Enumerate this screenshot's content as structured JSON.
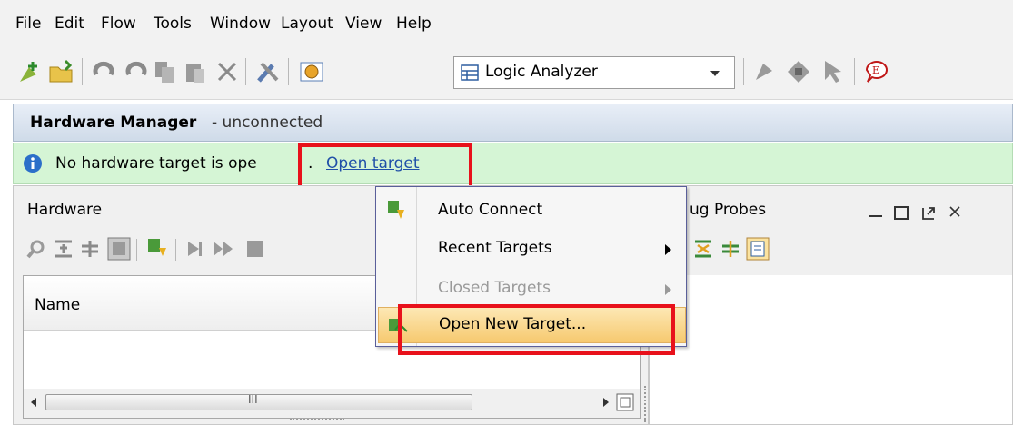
{
  "menu": [
    "File",
    "Edit",
    "Flow",
    "Tools",
    "Window",
    "Layout",
    "View",
    "Help"
  ],
  "toolbar": {
    "layout_value": "Logic Analyzer"
  },
  "hw_manager": {
    "title": "Hardware Manager",
    "status": "- unconnected"
  },
  "info": {
    "message": "No hardware target is ope",
    "suffix": ".",
    "link": "Open target"
  },
  "hardware_panel": {
    "title": "Hardware",
    "column_name": "Name",
    "scroll_label": "III"
  },
  "debug_panel": {
    "title": "ug Probes"
  },
  "context_menu": {
    "items": [
      {
        "label": "Auto Connect",
        "enabled": true
      },
      {
        "label": "Recent Targets",
        "enabled": true
      },
      {
        "label": "Closed Targets",
        "enabled": false
      },
      {
        "label": "Open New Target...",
        "enabled": true,
        "highlighted": true
      }
    ]
  },
  "colors": {
    "highlight_red": "#e8111b",
    "info_green": "#d5f5d5",
    "menu_hover": "#fbd98f",
    "link_blue": "#1f4fa8"
  }
}
